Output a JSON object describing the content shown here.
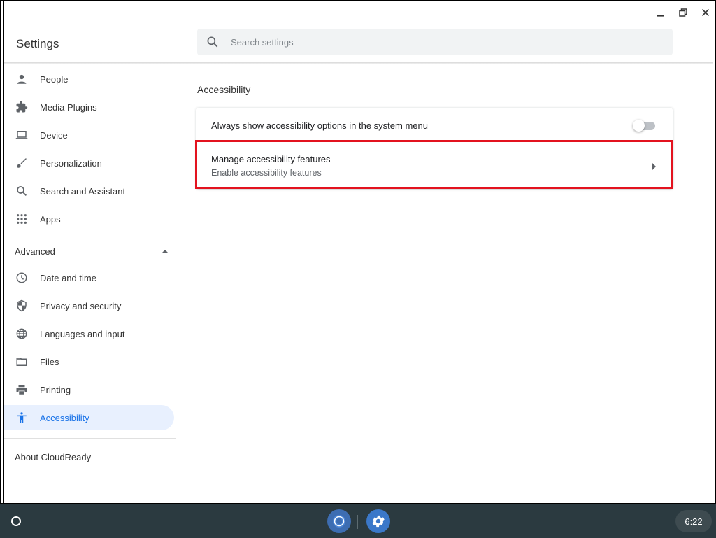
{
  "window": {
    "minimize_icon": "minimize-icon",
    "restore_icon": "restore-icon",
    "close_icon": "close-icon"
  },
  "header": {
    "title": "Settings",
    "search": {
      "placeholder": "Search settings",
      "value": ""
    }
  },
  "sidebar": {
    "items": [
      {
        "label": "People",
        "icon": "person-icon"
      },
      {
        "label": "Media Plugins",
        "icon": "puzzle-icon"
      },
      {
        "label": "Device",
        "icon": "laptop-icon"
      },
      {
        "label": "Personalization",
        "icon": "brush-icon"
      },
      {
        "label": "Search and Assistant",
        "icon": "search-icon"
      },
      {
        "label": "Apps",
        "icon": "apps-grid-icon"
      }
    ],
    "advanced": {
      "label": "Advanced",
      "expanded": true
    },
    "advanced_items": [
      {
        "label": "Date and time",
        "icon": "clock-icon"
      },
      {
        "label": "Privacy and security",
        "icon": "shield-icon"
      },
      {
        "label": "Languages and input",
        "icon": "globe-icon"
      },
      {
        "label": "Files",
        "icon": "folder-icon"
      },
      {
        "label": "Printing",
        "icon": "printer-icon"
      },
      {
        "label": "Accessibility",
        "icon": "accessibility-icon",
        "selected": true
      }
    ],
    "about": "About CloudReady"
  },
  "main": {
    "section_title": "Accessibility",
    "rows": [
      {
        "label": "Always show accessibility options in the system menu",
        "toggle_on": false
      },
      {
        "label": "Manage accessibility features",
        "sublabel": "Enable accessibility features"
      }
    ]
  },
  "shelf": {
    "time": "6:22",
    "apps": [
      "chrome-icon",
      "settings-gear-icon"
    ]
  },
  "colors": {
    "accent": "#1a73e8",
    "selected_bg": "#e8f0fe",
    "highlight": "#e3131f",
    "shelf_bg": "#2b3a40"
  }
}
